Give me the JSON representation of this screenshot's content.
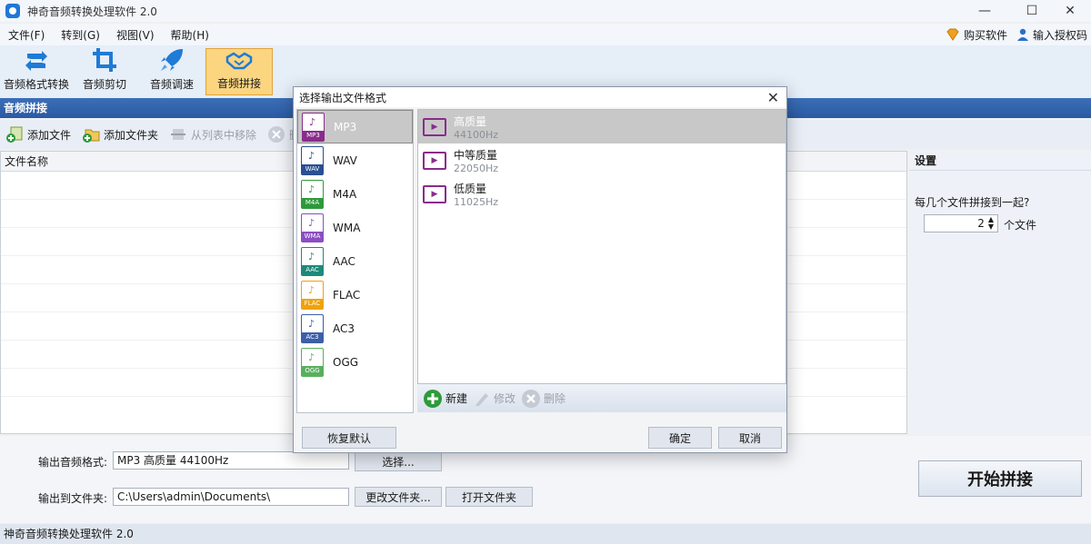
{
  "window": {
    "title": "神奇音频转换处理软件 2.0"
  },
  "menu": {
    "items": [
      "文件(F)",
      "转到(G)",
      "视图(V)",
      "帮助(H)"
    ],
    "buy": "购买软件",
    "license": "输入授权码"
  },
  "toolbar": {
    "buttons": [
      "音频格式转换",
      "音频剪切",
      "音频调速",
      "音频拼接"
    ],
    "active_index": 3
  },
  "section": {
    "title": "音频拼接"
  },
  "subtool": {
    "add_file": "添加文件",
    "add_folder": "添加文件夹",
    "remove": "从列表中移除",
    "delete": "删除"
  },
  "filelist": {
    "header": "文件名称"
  },
  "settings": {
    "title": "设置",
    "question": "每几个文件拼接到一起?",
    "count": "2",
    "unit": "个文件"
  },
  "output": {
    "format_label": "输出音频格式:",
    "format_value": "MP3 高质量 44100Hz",
    "choose_btn": "选择...",
    "folder_label": "输出到文件夹:",
    "folder_value": "C:\\Users\\admin\\Documents\\",
    "change_btn": "更改文件夹...",
    "open_btn": "打开文件夹"
  },
  "start_button": "开始拼接",
  "status": {
    "text": "神奇音频转换处理软件 2.0"
  },
  "dialog": {
    "title": "选择输出文件格式",
    "formats": [
      {
        "name": "MP3",
        "tag": "MP3",
        "color": "#8a2b8c"
      },
      {
        "name": "WAV",
        "tag": "WAV",
        "color": "#2a4f92"
      },
      {
        "name": "M4A",
        "tag": "M4A",
        "color": "#2e9a3b"
      },
      {
        "name": "WMA",
        "tag": "WMA",
        "color": "#8a4fc2"
      },
      {
        "name": "AAC",
        "tag": "AAC",
        "color": "#1d8a7a"
      },
      {
        "name": "FLAC",
        "tag": "FLAC",
        "color": "#f0a20a"
      },
      {
        "name": "AC3",
        "tag": "AC3",
        "color": "#3d5fa8"
      },
      {
        "name": "OGG",
        "tag": "OGG",
        "color": "#58b05c"
      }
    ],
    "selected_format": 0,
    "qualities": [
      {
        "title": "高质量",
        "sub": "44100Hz"
      },
      {
        "title": "中等质量",
        "sub": "22050Hz"
      },
      {
        "title": "低质量",
        "sub": "11025Hz"
      }
    ],
    "selected_quality": 0,
    "new_btn": "新建",
    "edit_btn": "修改",
    "delete_btn": "删除",
    "restore_btn": "恢复默认",
    "ok_btn": "确定",
    "cancel_btn": "取消"
  }
}
